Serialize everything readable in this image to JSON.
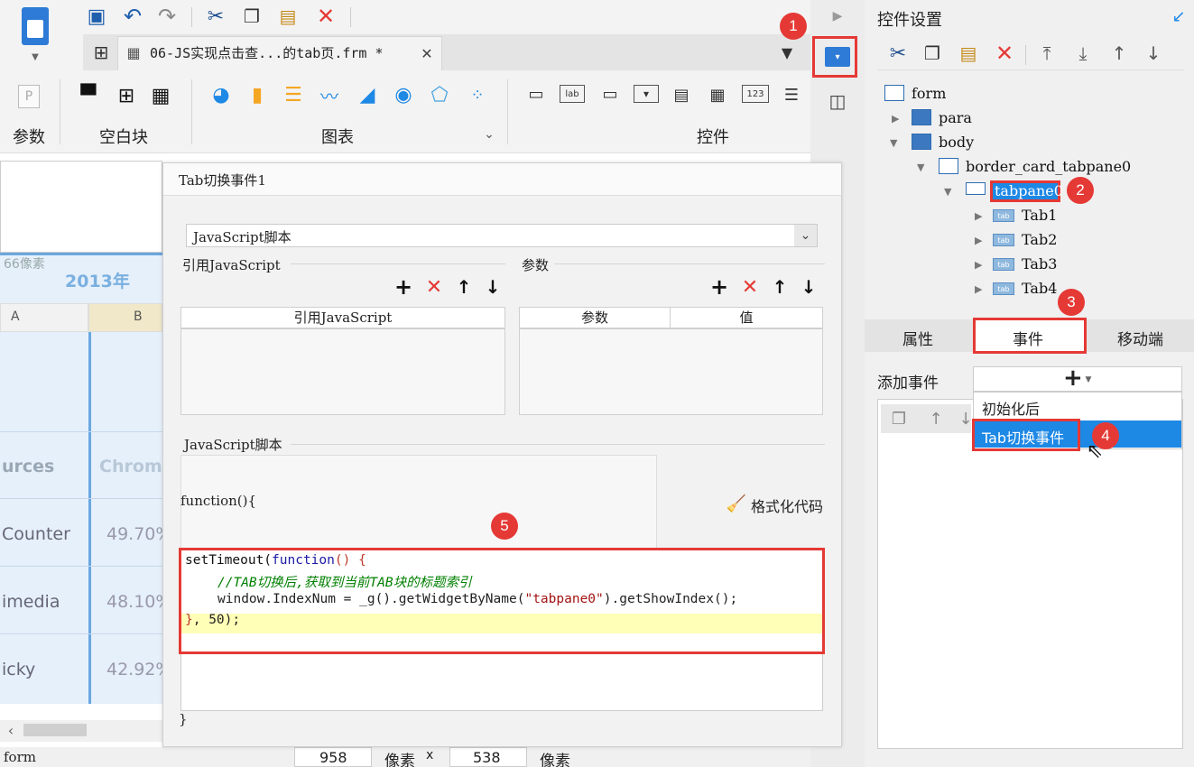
{
  "toolbar": {
    "doc_tab_title": "06-JS实现点击查...的tab页.frm *",
    "groups": [
      "参数",
      "空白块",
      "图表",
      "控件"
    ]
  },
  "sheet": {
    "size_text": "66像素",
    "year_header": "2013年",
    "col_a": "A",
    "col_b": "B",
    "rows": [
      {
        "name": "urces",
        "value": "Chrom"
      },
      {
        "name": "Counter",
        "value": "49.70%"
      },
      {
        "name": "imedia",
        "value": "48.10%"
      },
      {
        "name": "icky",
        "value": "42.92%"
      }
    ]
  },
  "status": {
    "name": "form",
    "width": "958",
    "px1": "像素",
    "x": "x",
    "height": "538",
    "px2": "像素"
  },
  "dialog": {
    "title": "Tab切换事件1",
    "script_type": "JavaScript脚本",
    "ref_js_section": "引用JavaScript",
    "params_section": "参数",
    "ref_js_col": "引用JavaScript",
    "param_col": "参数",
    "value_col": "值",
    "script_section": "JavaScript脚本",
    "function_header": "function(){",
    "format_code": "格式化代码",
    "code_line1a": "setTimeout(",
    "code_line1b": "function",
    "code_line1c": "() {",
    "code_comment": "//TAB切换后,获取到当前TAB块的标题索引",
    "code_line3a": "window.IndexNum = _g().getWidgetByName(",
    "code_line3b": "\"tabpane0\"",
    "code_line3c": ").getShowIndex();",
    "code_line4a": "}",
    "code_line4b": ", 50);",
    "closing_brace": "}"
  },
  "panel": {
    "title": "控件设置",
    "tree": [
      "form",
      "para",
      "body",
      "border_card_tabpane0",
      "tabpane0",
      "Tab1",
      "Tab2",
      "Tab3",
      "Tab4"
    ],
    "tabs": [
      "属性",
      "事件",
      "移动端"
    ],
    "add_event_label": "添加事件",
    "add_button": "+",
    "menu": [
      "初始化后",
      "Tab切换事件"
    ]
  },
  "callouts": [
    "1",
    "2",
    "3",
    "4",
    "5"
  ],
  "colors": {
    "accent": "#e53935",
    "selection": "#1e88e5",
    "highlight": "#ffffb8",
    "keyword": "#1a1aa6",
    "comment": "#008000",
    "string": "#a31515"
  }
}
